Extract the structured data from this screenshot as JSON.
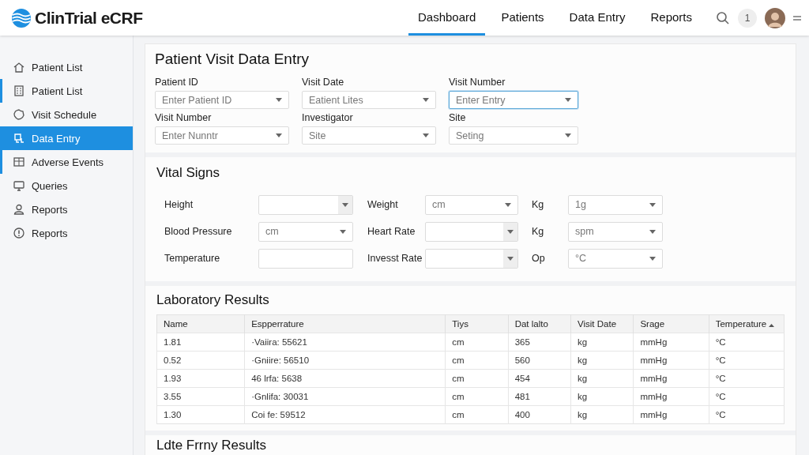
{
  "header": {
    "logo": "ClinTrial eCRF",
    "nav": [
      {
        "label": "Dashboard",
        "selected": true
      },
      {
        "label": "Patients",
        "selected": false
      },
      {
        "label": "Data Entry",
        "selected": false
      },
      {
        "label": "Reports",
        "selected": false
      }
    ],
    "notification_count": "1"
  },
  "sidebar": {
    "items": [
      {
        "label": "Patient List",
        "selected": false,
        "marked": false
      },
      {
        "label": "Patient List",
        "selected": false,
        "marked": true
      },
      {
        "label": "Visit Schedule",
        "selected": false,
        "marked": false
      },
      {
        "label": "Data Entry",
        "selected": true,
        "marked": false
      },
      {
        "label": "Adverse Events",
        "selected": false,
        "marked": true
      },
      {
        "label": "Queries",
        "selected": false,
        "marked": false
      },
      {
        "label": "Reports",
        "selected": false,
        "marked": false
      },
      {
        "label": "Reports",
        "selected": false,
        "marked": false
      }
    ]
  },
  "visit_form": {
    "title": "Patient Visit Data Entry",
    "fields": [
      {
        "label": "Patient ID",
        "placeholder": "Enter Patient ID",
        "focused": false
      },
      {
        "label": "Visit Date",
        "placeholder": "Eatient Lites",
        "focused": false
      },
      {
        "label": "Visit Number",
        "placeholder": "Enter Entry",
        "focused": true
      },
      {
        "label": "Visit Number",
        "placeholder": "Enter Nunntr",
        "focused": false
      },
      {
        "label": "Investigator",
        "placeholder": "Site",
        "focused": false
      },
      {
        "label": "Site",
        "placeholder": "Seting",
        "focused": false
      }
    ]
  },
  "vital_signs": {
    "title": "Vital Signs",
    "rows": [
      [
        {
          "label": "Height",
          "kind": "combo"
        },
        {
          "label": "Weight",
          "kind": "select",
          "value": "cm"
        },
        {
          "label": "Kg",
          "kind": "select",
          "value": "1g"
        }
      ],
      [
        {
          "label": "Blood Pressure",
          "kind": "select",
          "value": "cm"
        },
        {
          "label": "Heart Rate",
          "kind": "combo"
        },
        {
          "label": "Kg",
          "kind": "select",
          "value": "spm"
        }
      ],
      [
        {
          "label": "Temperature",
          "kind": "text"
        },
        {
          "label": "Invesst Rate",
          "kind": "combo"
        },
        {
          "label": "Op",
          "kind": "select",
          "value": "°C"
        }
      ]
    ]
  },
  "lab_results": {
    "title": "Laboratory Results",
    "columns": [
      {
        "label": "Name",
        "sorted": false
      },
      {
        "label": "Espperrature",
        "sorted": false
      },
      {
        "label": "Tiys",
        "sorted": false
      },
      {
        "label": "Dat lalto",
        "sorted": false
      },
      {
        "label": "Visit Date",
        "sorted": false
      },
      {
        "label": "Srage",
        "sorted": false
      },
      {
        "label": "Temperature",
        "sorted": true
      }
    ],
    "rows": [
      [
        "1.81",
        "·Vaiira: 55621",
        "cm",
        "365",
        "kg",
        "mmHg",
        "°C"
      ],
      [
        "0.52",
        "·Gniire: 56510",
        "cm",
        "560",
        "kg",
        "mmHg",
        "°C"
      ],
      [
        "1.93",
        "46 lrfa: 5638",
        "cm",
        "454",
        "kg",
        "mmHg",
        "°C"
      ],
      [
        "3.55",
        "·Gnlifa: 30031",
        "cm",
        "481",
        "kg",
        "mmHg",
        "°C"
      ],
      [
        "1.30",
        "Coi fe: 59512",
        "cm",
        "400",
        "kg",
        "mmHg",
        "°C"
      ]
    ]
  },
  "next_section": {
    "title": "Ldte Frrny Results"
  }
}
